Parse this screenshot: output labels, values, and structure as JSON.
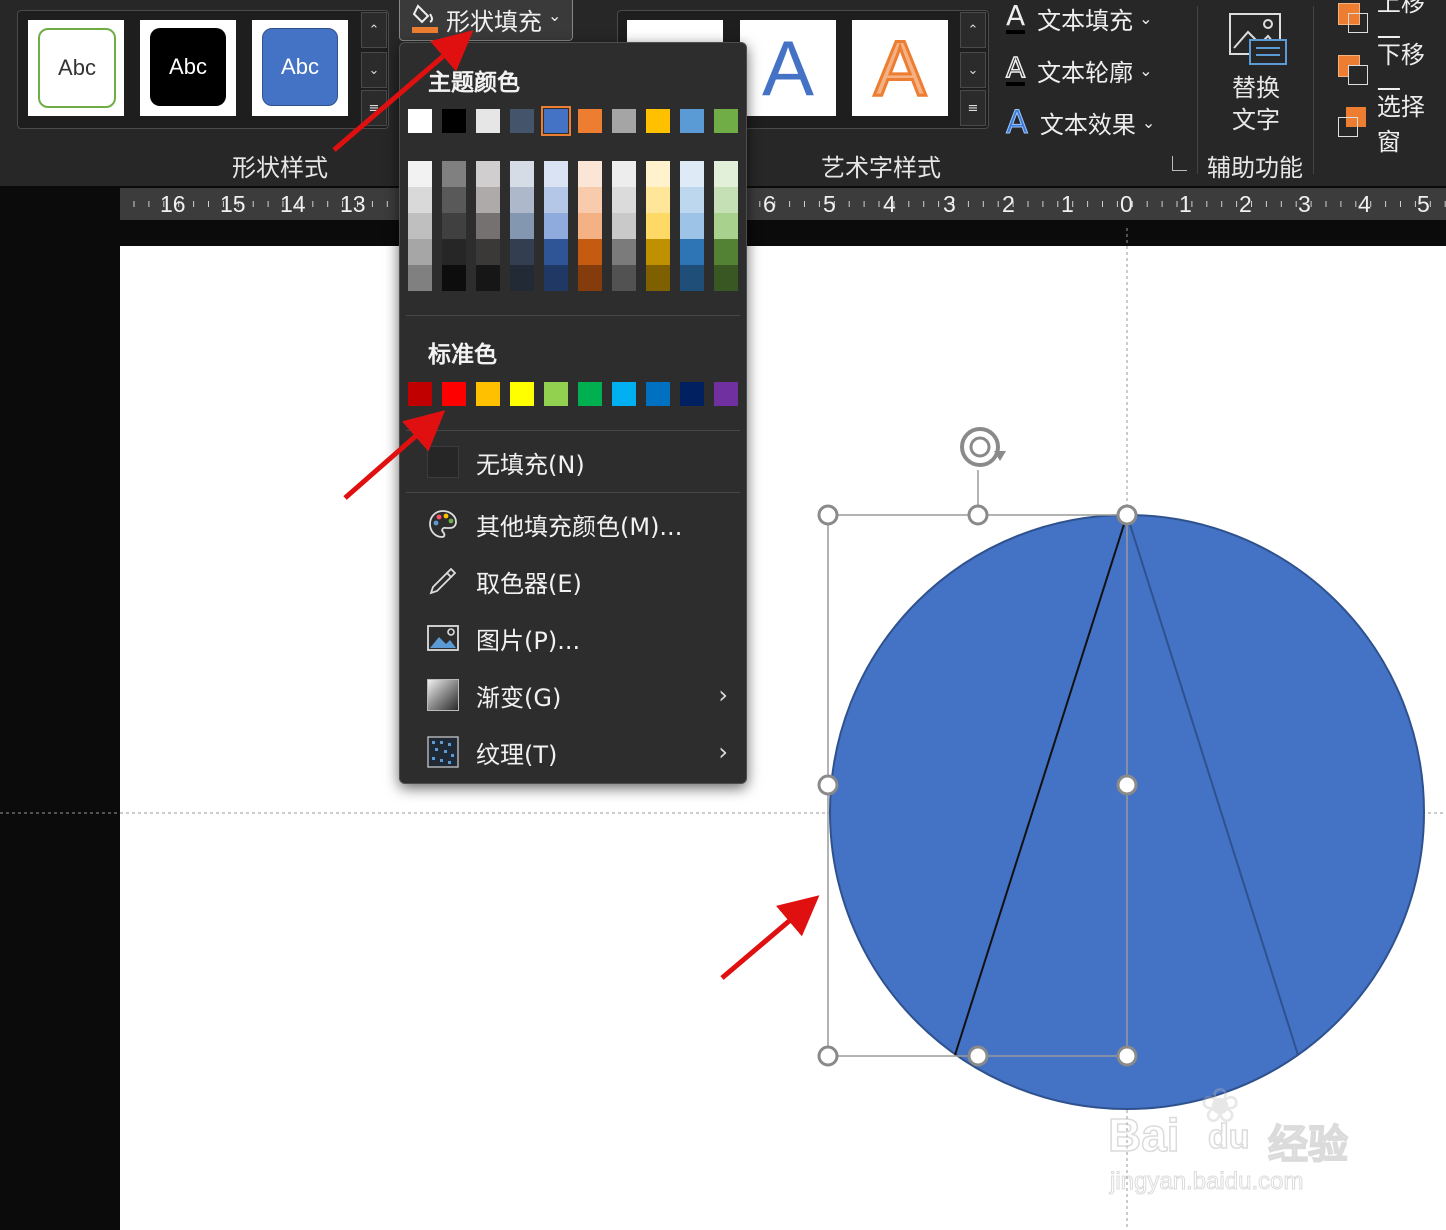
{
  "ribbon": {
    "shape_styles": {
      "group_label": "形状样式",
      "tiles": [
        {
          "label": "Abc",
          "style": "outline-green"
        },
        {
          "label": "Abc",
          "style": "black"
        },
        {
          "label": "Abc",
          "style": "blue"
        }
      ]
    },
    "shape_fill_button": "形状填充",
    "wordart": {
      "group_label": "艺术字样式",
      "tile_letters": [
        "A",
        "A"
      ],
      "text_fill": "文本填充",
      "text_outline": "文本轮廓",
      "text_effects": "文本效果"
    },
    "accessibility": {
      "alt_text_line1": "替换",
      "alt_text_line2": "文字",
      "group_label": "辅助功能"
    },
    "arrange": {
      "bring_forward": "上移一",
      "send_backward": "下移一",
      "selection_pane": "选择窗"
    },
    "colors": {
      "orange_accent": "#ED7D31",
      "blue_accent": "#4472C4"
    }
  },
  "ruler": {
    "labels": [
      "16",
      "15",
      "14",
      "13",
      "6",
      "5",
      "4",
      "3",
      "2",
      "1",
      "0",
      "1",
      "2",
      "3",
      "4",
      "5"
    ]
  },
  "fill_menu": {
    "theme_colors_header": "主题颜色",
    "theme_row": [
      "#FFFFFF",
      "#000000",
      "#E7E6E6",
      "#44546A",
      "#4472C4",
      "#ED7D31",
      "#A5A5A5",
      "#FFC000",
      "#5B9BD5",
      "#70AD47"
    ],
    "theme_shades": [
      [
        "#F2F2F2",
        "#D9D9D9",
        "#BFBFBF",
        "#A6A6A6",
        "#808080"
      ],
      [
        "#808080",
        "#595959",
        "#404040",
        "#262626",
        "#0D0D0D"
      ],
      [
        "#D0CECE",
        "#AEAAAA",
        "#757171",
        "#3B3838",
        "#171616"
      ],
      [
        "#D6DCE5",
        "#ADB9CA",
        "#8497B0",
        "#333F50",
        "#222A35"
      ],
      [
        "#DAE3F3",
        "#B4C7E7",
        "#8FAADC",
        "#2F5597",
        "#1F3864"
      ],
      [
        "#FBE5D6",
        "#F8CBAD",
        "#F4B183",
        "#C55A11",
        "#843C0C"
      ],
      [
        "#EDEDED",
        "#DBDBDB",
        "#C9C9C9",
        "#7B7B7B",
        "#525252"
      ],
      [
        "#FFF2CC",
        "#FFE699",
        "#FFD966",
        "#BF9000",
        "#7F6000"
      ],
      [
        "#DEEBF7",
        "#BDD7EE",
        "#9DC3E6",
        "#2E75B6",
        "#1F4E79"
      ],
      [
        "#E2F0D9",
        "#C5E0B4",
        "#A9D18E",
        "#548235",
        "#385723"
      ]
    ],
    "standard_colors_header": "标准色",
    "standard_row": [
      "#C00000",
      "#FF0000",
      "#FFC000",
      "#FFFF00",
      "#92D050",
      "#00B050",
      "#00B0F0",
      "#0070C0",
      "#002060",
      "#7030A0"
    ],
    "no_fill": "无填充(N)",
    "more_colors": "其他填充颜色(M)...",
    "eyedropper": "取色器(E)",
    "picture": "图片(P)...",
    "gradient": "渐变(G)",
    "texture": "纹理(T)"
  },
  "slide": {
    "shape_fill": "#4472C4",
    "shape_outline": "#2F528F"
  },
  "watermark": {
    "line1": "Bai",
    "line2": "du",
    "line3": "经验",
    "url": "jingyan.baidu.com"
  }
}
